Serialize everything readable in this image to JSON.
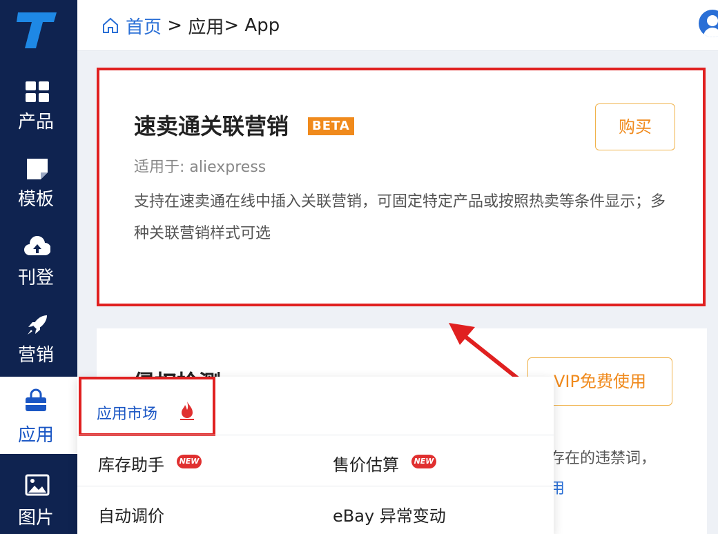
{
  "sidebar": {
    "items": [
      {
        "label": "产品",
        "icon": "grid-icon"
      },
      {
        "label": "模板",
        "icon": "note-icon"
      },
      {
        "label": "刊登",
        "icon": "cloud-upload-icon"
      },
      {
        "label": "营销",
        "icon": "rocket-icon"
      },
      {
        "label": "应用",
        "icon": "shopping-bag-icon",
        "active": true
      },
      {
        "label": "图片",
        "icon": "image-icon"
      }
    ]
  },
  "header": {
    "breadcrumb": {
      "home": "首页",
      "sep1": " > ",
      "apps": "应用",
      "sep2": "> ",
      "current": "App"
    }
  },
  "card1": {
    "title": "速卖通关联营销",
    "badge": "BETA",
    "applies_to": "适用于: aliexpress",
    "description": "支持在速卖通在线中插入关联营销，可固定特定产品或按照热卖等条件显示；多种关联营销样式可选",
    "buy_label": "购买"
  },
  "card2": {
    "title": "侵权检测",
    "vip_label": "VIP免费使用",
    "partial_text": "存在的违禁词，",
    "partial_link": "用"
  },
  "popup": {
    "market_label": "应用市场",
    "items": [
      {
        "label": "库存助手",
        "badge": "NEW"
      },
      {
        "label": "售价估算",
        "badge": "NEW"
      },
      {
        "label": "自动调价"
      },
      {
        "label": "eBay 异常变动"
      }
    ]
  },
  "colors": {
    "sidebar": "#0f2350",
    "accent": "#1a56c4",
    "highlight": "#e02020",
    "orange": "#f08a1c"
  }
}
